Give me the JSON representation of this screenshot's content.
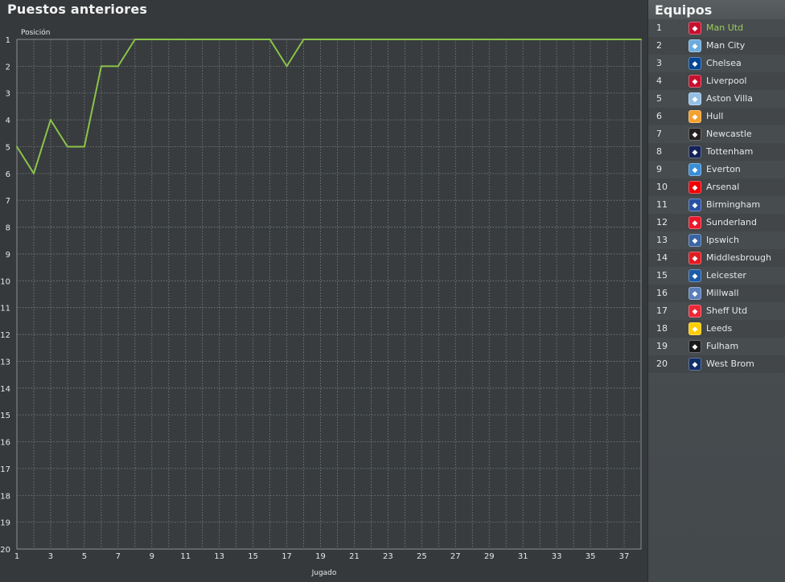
{
  "title": "Puestos anteriores",
  "chart_data": {
    "type": "line",
    "ylabel": "Posición",
    "xlabel": "Jugado",
    "xlim": [
      1,
      38
    ],
    "ylim": [
      1,
      20
    ],
    "y_inverted": true,
    "grid": true,
    "x_ticks": [
      1,
      3,
      5,
      7,
      9,
      11,
      13,
      15,
      17,
      19,
      21,
      23,
      25,
      27,
      29,
      31,
      33,
      35,
      37
    ],
    "y_ticks": [
      1,
      2,
      3,
      4,
      5,
      6,
      7,
      8,
      9,
      10,
      11,
      12,
      13,
      14,
      15,
      16,
      17,
      18,
      19,
      20
    ],
    "series": [
      {
        "name": "Man Utd",
        "color": "#8bc34a",
        "x": [
          1,
          2,
          3,
          4,
          5,
          6,
          7,
          8,
          9,
          10,
          11,
          12,
          13,
          14,
          15,
          16,
          17,
          18,
          19,
          20,
          21,
          22,
          23,
          24,
          25,
          26,
          27,
          28,
          29,
          30,
          31,
          32,
          33,
          34,
          35,
          36,
          37,
          38
        ],
        "values": [
          5,
          6,
          4,
          5,
          5,
          2,
          2,
          1,
          1,
          1,
          1,
          1,
          1,
          1,
          1,
          1,
          2,
          1,
          1,
          1,
          1,
          1,
          1,
          1,
          1,
          1,
          1,
          1,
          1,
          1,
          1,
          1,
          1,
          1,
          1,
          1,
          1,
          1
        ]
      }
    ]
  },
  "teams_panel": {
    "title": "Equipos",
    "highlight_color": "#9acd5a",
    "teams": [
      {
        "pos": "1",
        "name": "Man Utd",
        "icon": "man-utd-crest",
        "color": "#c8102e",
        "highlight": true
      },
      {
        "pos": "2",
        "name": "Man City",
        "icon": "man-city-crest",
        "color": "#6cabdd"
      },
      {
        "pos": "3",
        "name": "Chelsea",
        "icon": "chelsea-crest",
        "color": "#034694"
      },
      {
        "pos": "4",
        "name": "Liverpool",
        "icon": "liverpool-crest",
        "color": "#c8102e"
      },
      {
        "pos": "5",
        "name": "Aston Villa",
        "icon": "aston-villa-crest",
        "color": "#95bfe5"
      },
      {
        "pos": "6",
        "name": "Hull",
        "icon": "hull-crest",
        "color": "#f5a12d"
      },
      {
        "pos": "7",
        "name": "Newcastle",
        "icon": "newcastle-crest",
        "color": "#241f20"
      },
      {
        "pos": "8",
        "name": "Tottenham",
        "icon": "tottenham-crest",
        "color": "#132257"
      },
      {
        "pos": "9",
        "name": "Everton",
        "icon": "everton-crest",
        "color": "#3b8fd6"
      },
      {
        "pos": "10",
        "name": "Arsenal",
        "icon": "arsenal-crest",
        "color": "#ef0107"
      },
      {
        "pos": "11",
        "name": "Birmingham",
        "icon": "birmingham-crest",
        "color": "#2851a3"
      },
      {
        "pos": "12",
        "name": "Sunderland",
        "icon": "sunderland-crest",
        "color": "#eb172b"
      },
      {
        "pos": "13",
        "name": "Ipswich",
        "icon": "ipswich-crest",
        "color": "#3a64a3"
      },
      {
        "pos": "14",
        "name": "Middlesbrough",
        "icon": "middlesbrough-crest",
        "color": "#e11b22"
      },
      {
        "pos": "15",
        "name": "Leicester",
        "icon": "leicester-crest",
        "color": "#1d5ba4"
      },
      {
        "pos": "16",
        "name": "Millwall",
        "icon": "millwall-crest",
        "color": "#5b7fb8"
      },
      {
        "pos": "17",
        "name": "Sheff Utd",
        "icon": "sheff-utd-crest",
        "color": "#ee2737"
      },
      {
        "pos": "18",
        "name": "Leeds",
        "icon": "leeds-crest",
        "color": "#ffcd00"
      },
      {
        "pos": "19",
        "name": "Fulham",
        "icon": "fulham-crest",
        "color": "#1a1a1a"
      },
      {
        "pos": "20",
        "name": "West Brom",
        "icon": "west-brom-crest",
        "color": "#122f67"
      }
    ]
  }
}
